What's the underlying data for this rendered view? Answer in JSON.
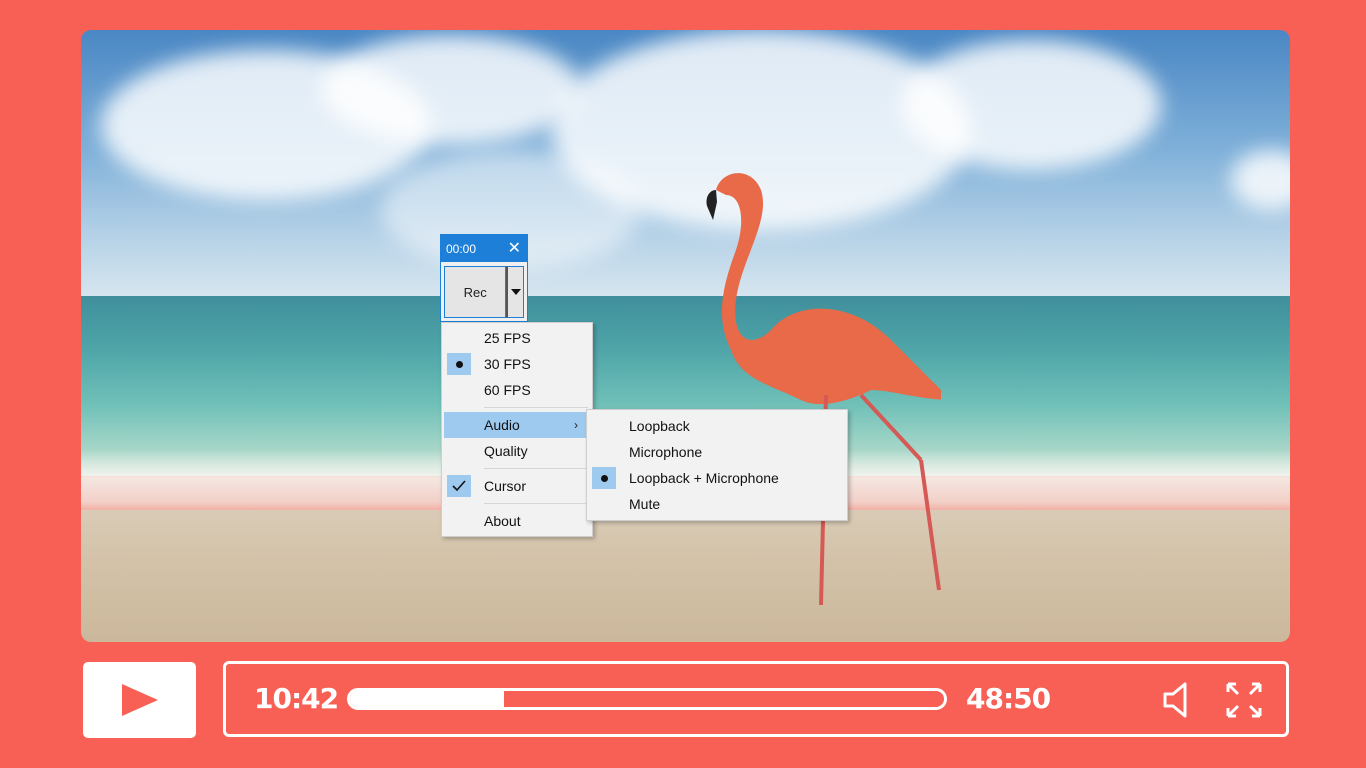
{
  "recorder": {
    "timer": "00:00",
    "close_icon": "close-icon",
    "rec_label": "Rec",
    "dropdown_icon": "triangle-down-icon"
  },
  "menu": {
    "items": [
      {
        "label": "25 FPS",
        "state": "none"
      },
      {
        "label": "30 FPS",
        "state": "selected-dot"
      },
      {
        "label": "60 FPS",
        "state": "none"
      },
      {
        "label": "Audio",
        "state": "submenu-open"
      },
      {
        "label": "Quality",
        "state": "none"
      },
      {
        "label": "Cursor",
        "state": "checked"
      },
      {
        "label": "About",
        "state": "none"
      }
    ],
    "submenu_arrow": "›"
  },
  "audio_submenu": {
    "items": [
      {
        "label": "Loopback",
        "state": "none"
      },
      {
        "label": "Microphone",
        "state": "none"
      },
      {
        "label": "Loopback + Microphone",
        "state": "selected-dot"
      },
      {
        "label": "Mute",
        "state": "none"
      }
    ]
  },
  "player": {
    "current_time": "10:42",
    "total_time": "48:50",
    "progress": 0.26,
    "play_icon": "play-icon",
    "volume_icon": "volume-icon",
    "fullscreen_icon": "fullscreen-icon"
  },
  "colors": {
    "background": "#f85f55",
    "accent_blue": "#1e7fd8",
    "menu_highlight": "#9fcaf0",
    "controls": "#ffffff"
  }
}
